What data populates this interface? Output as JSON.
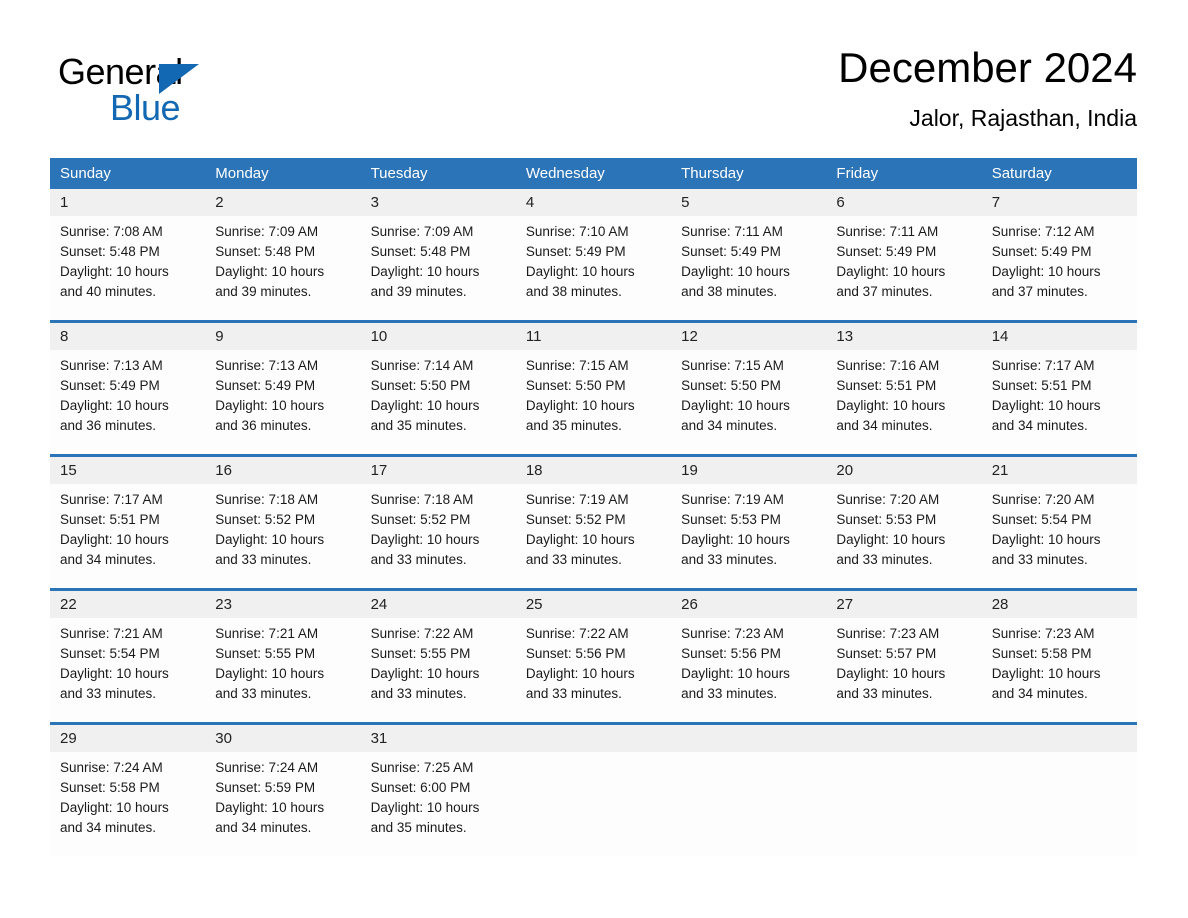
{
  "brand": {
    "word_one": "General",
    "word_two": "Blue",
    "triangle_icon": "blue-triangle-logo",
    "colors": {
      "blue": "#1268b3",
      "black": "#000000"
    }
  },
  "header": {
    "title": "December 2024",
    "location": "Jalor, Rajasthan, India"
  },
  "theme": {
    "header_blue": "#2b74b8",
    "daynum_band": "#f0f0f0",
    "cell_bg": "#fdfdfd",
    "text": "#1a1a1a"
  },
  "weekdays": [
    "Sunday",
    "Monday",
    "Tuesday",
    "Wednesday",
    "Thursday",
    "Friday",
    "Saturday"
  ],
  "weeks": [
    {
      "days": [
        {
          "date": "1",
          "sunrise": "Sunrise: 7:08 AM",
          "sunset": "Sunset: 5:48 PM",
          "daylight_1": "Daylight: 10 hours",
          "daylight_2": "and 40 minutes."
        },
        {
          "date": "2",
          "sunrise": "Sunrise: 7:09 AM",
          "sunset": "Sunset: 5:48 PM",
          "daylight_1": "Daylight: 10 hours",
          "daylight_2": "and 39 minutes."
        },
        {
          "date": "3",
          "sunrise": "Sunrise: 7:09 AM",
          "sunset": "Sunset: 5:48 PM",
          "daylight_1": "Daylight: 10 hours",
          "daylight_2": "and 39 minutes."
        },
        {
          "date": "4",
          "sunrise": "Sunrise: 7:10 AM",
          "sunset": "Sunset: 5:49 PM",
          "daylight_1": "Daylight: 10 hours",
          "daylight_2": "and 38 minutes."
        },
        {
          "date": "5",
          "sunrise": "Sunrise: 7:11 AM",
          "sunset": "Sunset: 5:49 PM",
          "daylight_1": "Daylight: 10 hours",
          "daylight_2": "and 38 minutes."
        },
        {
          "date": "6",
          "sunrise": "Sunrise: 7:11 AM",
          "sunset": "Sunset: 5:49 PM",
          "daylight_1": "Daylight: 10 hours",
          "daylight_2": "and 37 minutes."
        },
        {
          "date": "7",
          "sunrise": "Sunrise: 7:12 AM",
          "sunset": "Sunset: 5:49 PM",
          "daylight_1": "Daylight: 10 hours",
          "daylight_2": "and 37 minutes."
        }
      ]
    },
    {
      "days": [
        {
          "date": "8",
          "sunrise": "Sunrise: 7:13 AM",
          "sunset": "Sunset: 5:49 PM",
          "daylight_1": "Daylight: 10 hours",
          "daylight_2": "and 36 minutes."
        },
        {
          "date": "9",
          "sunrise": "Sunrise: 7:13 AM",
          "sunset": "Sunset: 5:49 PM",
          "daylight_1": "Daylight: 10 hours",
          "daylight_2": "and 36 minutes."
        },
        {
          "date": "10",
          "sunrise": "Sunrise: 7:14 AM",
          "sunset": "Sunset: 5:50 PM",
          "daylight_1": "Daylight: 10 hours",
          "daylight_2": "and 35 minutes."
        },
        {
          "date": "11",
          "sunrise": "Sunrise: 7:15 AM",
          "sunset": "Sunset: 5:50 PM",
          "daylight_1": "Daylight: 10 hours",
          "daylight_2": "and 35 minutes."
        },
        {
          "date": "12",
          "sunrise": "Sunrise: 7:15 AM",
          "sunset": "Sunset: 5:50 PM",
          "daylight_1": "Daylight: 10 hours",
          "daylight_2": "and 34 minutes."
        },
        {
          "date": "13",
          "sunrise": "Sunrise: 7:16 AM",
          "sunset": "Sunset: 5:51 PM",
          "daylight_1": "Daylight: 10 hours",
          "daylight_2": "and 34 minutes."
        },
        {
          "date": "14",
          "sunrise": "Sunrise: 7:17 AM",
          "sunset": "Sunset: 5:51 PM",
          "daylight_1": "Daylight: 10 hours",
          "daylight_2": "and 34 minutes."
        }
      ]
    },
    {
      "days": [
        {
          "date": "15",
          "sunrise": "Sunrise: 7:17 AM",
          "sunset": "Sunset: 5:51 PM",
          "daylight_1": "Daylight: 10 hours",
          "daylight_2": "and 34 minutes."
        },
        {
          "date": "16",
          "sunrise": "Sunrise: 7:18 AM",
          "sunset": "Sunset: 5:52 PM",
          "daylight_1": "Daylight: 10 hours",
          "daylight_2": "and 33 minutes."
        },
        {
          "date": "17",
          "sunrise": "Sunrise: 7:18 AM",
          "sunset": "Sunset: 5:52 PM",
          "daylight_1": "Daylight: 10 hours",
          "daylight_2": "and 33 minutes."
        },
        {
          "date": "18",
          "sunrise": "Sunrise: 7:19 AM",
          "sunset": "Sunset: 5:52 PM",
          "daylight_1": "Daylight: 10 hours",
          "daylight_2": "and 33 minutes."
        },
        {
          "date": "19",
          "sunrise": "Sunrise: 7:19 AM",
          "sunset": "Sunset: 5:53 PM",
          "daylight_1": "Daylight: 10 hours",
          "daylight_2": "and 33 minutes."
        },
        {
          "date": "20",
          "sunrise": "Sunrise: 7:20 AM",
          "sunset": "Sunset: 5:53 PM",
          "daylight_1": "Daylight: 10 hours",
          "daylight_2": "and 33 minutes."
        },
        {
          "date": "21",
          "sunrise": "Sunrise: 7:20 AM",
          "sunset": "Sunset: 5:54 PM",
          "daylight_1": "Daylight: 10 hours",
          "daylight_2": "and 33 minutes."
        }
      ]
    },
    {
      "days": [
        {
          "date": "22",
          "sunrise": "Sunrise: 7:21 AM",
          "sunset": "Sunset: 5:54 PM",
          "daylight_1": "Daylight: 10 hours",
          "daylight_2": "and 33 minutes."
        },
        {
          "date": "23",
          "sunrise": "Sunrise: 7:21 AM",
          "sunset": "Sunset: 5:55 PM",
          "daylight_1": "Daylight: 10 hours",
          "daylight_2": "and 33 minutes."
        },
        {
          "date": "24",
          "sunrise": "Sunrise: 7:22 AM",
          "sunset": "Sunset: 5:55 PM",
          "daylight_1": "Daylight: 10 hours",
          "daylight_2": "and 33 minutes."
        },
        {
          "date": "25",
          "sunrise": "Sunrise: 7:22 AM",
          "sunset": "Sunset: 5:56 PM",
          "daylight_1": "Daylight: 10 hours",
          "daylight_2": "and 33 minutes."
        },
        {
          "date": "26",
          "sunrise": "Sunrise: 7:23 AM",
          "sunset": "Sunset: 5:56 PM",
          "daylight_1": "Daylight: 10 hours",
          "daylight_2": "and 33 minutes."
        },
        {
          "date": "27",
          "sunrise": "Sunrise: 7:23 AM",
          "sunset": "Sunset: 5:57 PM",
          "daylight_1": "Daylight: 10 hours",
          "daylight_2": "and 33 minutes."
        },
        {
          "date": "28",
          "sunrise": "Sunrise: 7:23 AM",
          "sunset": "Sunset: 5:58 PM",
          "daylight_1": "Daylight: 10 hours",
          "daylight_2": "and 34 minutes."
        }
      ]
    },
    {
      "days": [
        {
          "date": "29",
          "sunrise": "Sunrise: 7:24 AM",
          "sunset": "Sunset: 5:58 PM",
          "daylight_1": "Daylight: 10 hours",
          "daylight_2": "and 34 minutes."
        },
        {
          "date": "30",
          "sunrise": "Sunrise: 7:24 AM",
          "sunset": "Sunset: 5:59 PM",
          "daylight_1": "Daylight: 10 hours",
          "daylight_2": "and 34 minutes."
        },
        {
          "date": "31",
          "sunrise": "Sunrise: 7:25 AM",
          "sunset": "Sunset: 6:00 PM",
          "daylight_1": "Daylight: 10 hours",
          "daylight_2": "and 35 minutes."
        },
        {
          "date": "",
          "sunrise": "",
          "sunset": "",
          "daylight_1": "",
          "daylight_2": ""
        },
        {
          "date": "",
          "sunrise": "",
          "sunset": "",
          "daylight_1": "",
          "daylight_2": ""
        },
        {
          "date": "",
          "sunrise": "",
          "sunset": "",
          "daylight_1": "",
          "daylight_2": ""
        },
        {
          "date": "",
          "sunrise": "",
          "sunset": "",
          "daylight_1": "",
          "daylight_2": ""
        }
      ]
    }
  ]
}
